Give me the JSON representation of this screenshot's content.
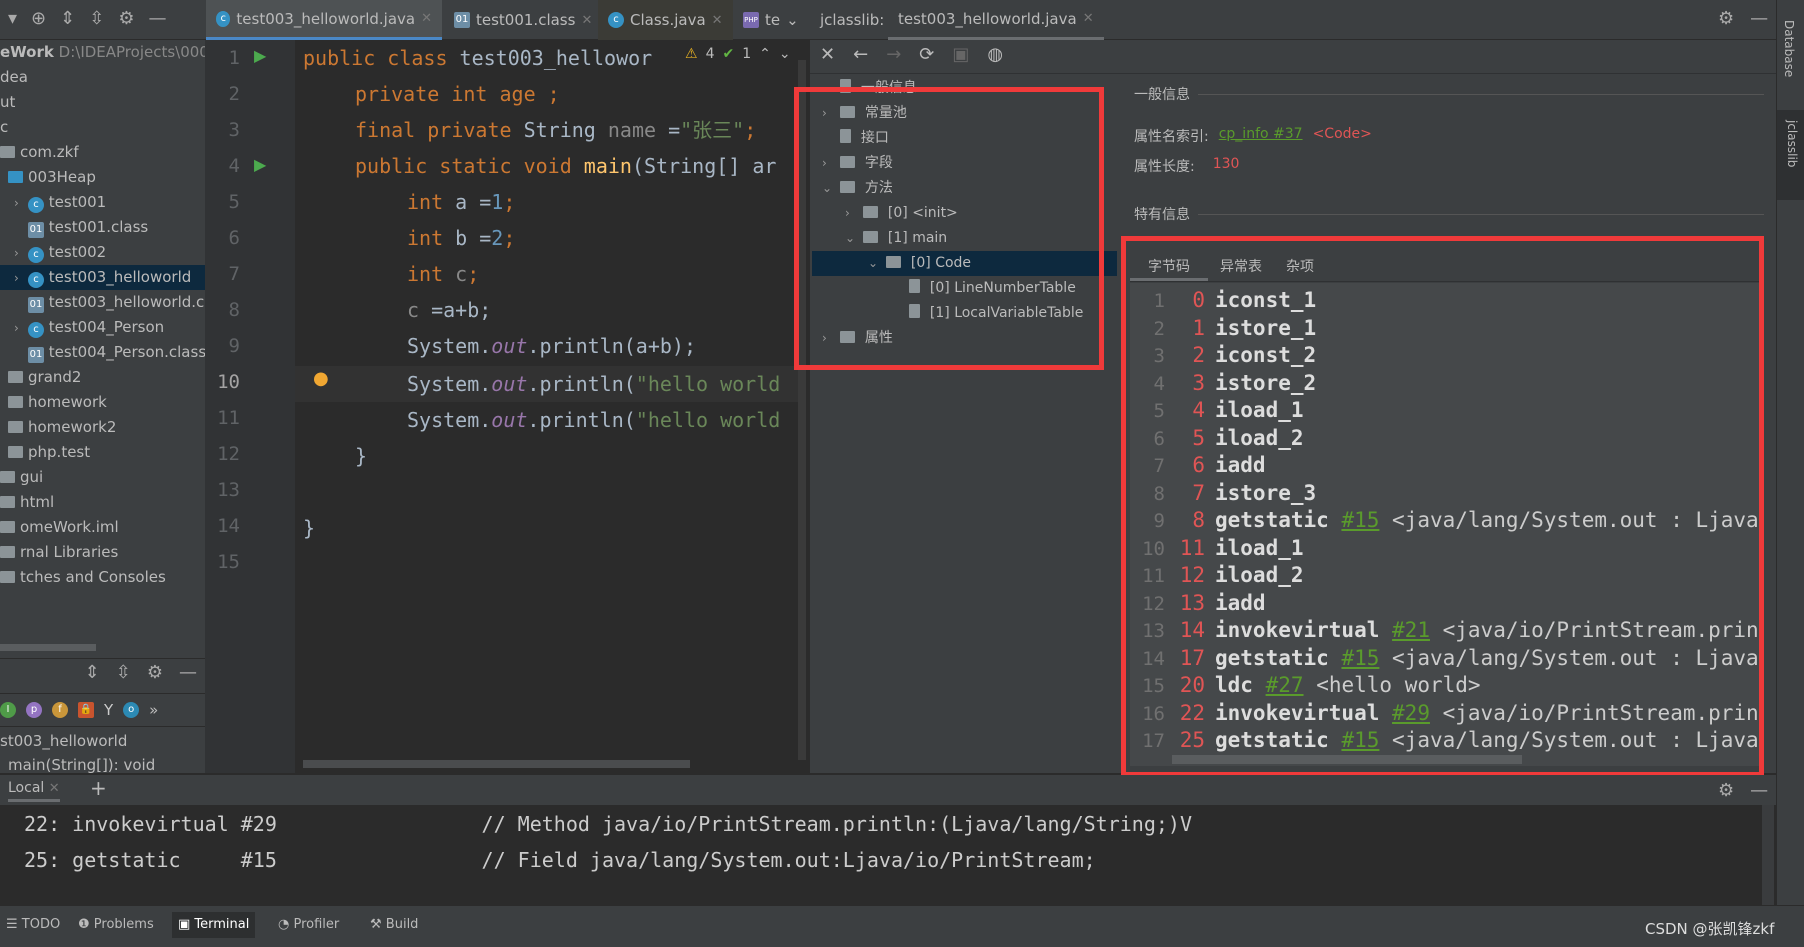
{
  "editor_tabs": [
    {
      "label": "test003_helloworld.java",
      "active": true
    },
    {
      "label": "test001.class"
    },
    {
      "label": "Class.java"
    },
    {
      "label": "te"
    }
  ],
  "project": {
    "root": "eWork",
    "root_path": "D:\\IDEAProjects\\000",
    "rows": [
      {
        "label": "dea",
        "indent": 0
      },
      {
        "label": "ut",
        "indent": 0
      },
      {
        "label": "c",
        "indent": 0
      },
      {
        "label": "com.zkf",
        "indent": 0
      },
      {
        "label": "003Heap",
        "indent": 1
      },
      {
        "label": "test001",
        "indent": 2,
        "arrow": true
      },
      {
        "label": "test001.class",
        "indent": 2
      },
      {
        "label": "test002",
        "indent": 2,
        "arrow": true
      },
      {
        "label": "test003_helloworld",
        "indent": 2,
        "arrow": true,
        "selected": true
      },
      {
        "label": "test003_helloworld.c",
        "indent": 2
      },
      {
        "label": "test004_Person",
        "indent": 2,
        "arrow": true
      },
      {
        "label": "test004_Person.class",
        "indent": 2
      },
      {
        "label": "grand2",
        "indent": 1
      },
      {
        "label": "homework",
        "indent": 1
      },
      {
        "label": "homework2",
        "indent": 1
      },
      {
        "label": "php.test",
        "indent": 1
      },
      {
        "label": "gui",
        "indent": 0
      },
      {
        "label": "html",
        "indent": 0
      },
      {
        "label": "omeWork.iml",
        "indent": 0
      },
      {
        "label": "rnal Libraries",
        "indent": 0
      },
      {
        "label": "tches and Consoles",
        "indent": 0
      }
    ]
  },
  "structure": {
    "class_name": "st003_helloworld",
    "method": "main(String[]): void"
  },
  "editor": {
    "inspections": {
      "warnings": "4",
      "ok": "1"
    },
    "lines": [
      "1",
      "2",
      "3",
      "4",
      "5",
      "6",
      "7",
      "8",
      "9",
      "10",
      "11",
      "12",
      "13",
      "14",
      "15"
    ],
    "code": {
      "l1a": "public class ",
      "l1b": "test003_hellowor",
      "l2a": "private int ",
      "l2b": "age ;",
      "l3a": "final private ",
      "l3b": "String ",
      "l3c": "name ",
      "l3d": "=",
      "l3e": "\"张三\"",
      "l3f": ";",
      "l4a": "public static void ",
      "l4b": "main",
      "l4c": "(String[] ar",
      "l5a": "int ",
      "l5b": "a =",
      "l5c": "1",
      "l5d": ";",
      "l6a": "int ",
      "l6b": "b =",
      "l6c": "2",
      "l6d": ";",
      "l7a": "int ",
      "l7b": "c",
      "l7c": ";",
      "l8a": "c ",
      "l8b": "=a+b;",
      "l9a": "System.",
      "l9b": "out",
      "l9c": ".println(a+b);",
      "l10a": "System.",
      "l10b": "out",
      "l10c": ".println(",
      "l10d": "\"hello world",
      "l11a": "System.",
      "l11b": "out",
      "l11c": ".println(",
      "l11d": "\"hello world",
      "l12": "}",
      "l14": "}"
    }
  },
  "jclasslib": {
    "title": "jclasslib:",
    "tab": "test003_helloworld.java",
    "tree": [
      {
        "label": "一般信息",
        "depth": 0
      },
      {
        "label": "常量池",
        "depth": 0,
        "arrow": "right"
      },
      {
        "label": "接口",
        "depth": 0
      },
      {
        "label": "字段",
        "depth": 0,
        "arrow": "right"
      },
      {
        "label": "方法",
        "depth": 0,
        "arrow": "down"
      },
      {
        "label": "[0] <init>",
        "depth": 1,
        "arrow": "right"
      },
      {
        "label": "[1] main",
        "depth": 1,
        "arrow": "down"
      },
      {
        "label": "[0] Code",
        "depth": 2,
        "arrow": "down",
        "selected": true
      },
      {
        "label": "[0] LineNumberTable",
        "depth": 3
      },
      {
        "label": "[1] LocalVariableTable",
        "depth": 3
      },
      {
        "label": "属性",
        "depth": 0,
        "arrow": "right"
      }
    ],
    "general": {
      "heading": "一般信息",
      "name_index_label": "属性名索引:",
      "name_index_link": "cp_info #37",
      "name_index_value": "<Code>",
      "length_label": "属性长度:",
      "length_value": "130"
    },
    "specific": {
      "heading": "特有信息",
      "tabs": [
        "字节码",
        "异常表",
        "杂项"
      ]
    },
    "bytecode": [
      {
        "n": "1",
        "o": "0",
        "op": "iconst_1"
      },
      {
        "n": "2",
        "o": "1",
        "op": "istore_1"
      },
      {
        "n": "3",
        "o": "2",
        "op": "iconst_2"
      },
      {
        "n": "4",
        "o": "3",
        "op": "istore_2"
      },
      {
        "n": "5",
        "o": "4",
        "op": "iload_1"
      },
      {
        "n": "6",
        "o": "5",
        "op": "iload_2"
      },
      {
        "n": "7",
        "o": "6",
        "op": "iadd"
      },
      {
        "n": "8",
        "o": "7",
        "op": "istore_3"
      },
      {
        "n": "9",
        "o": "8",
        "op": "getstatic",
        "ref": "#15",
        "cm": "<java/lang/System.out : Ljava"
      },
      {
        "n": "10",
        "o": "11",
        "op": "iload_1"
      },
      {
        "n": "11",
        "o": "12",
        "op": "iload_2"
      },
      {
        "n": "12",
        "o": "13",
        "op": "iadd"
      },
      {
        "n": "13",
        "o": "14",
        "op": "invokevirtual",
        "ref": "#21",
        "cm": "<java/io/PrintStream.prin"
      },
      {
        "n": "14",
        "o": "17",
        "op": "getstatic",
        "ref": "#15",
        "cm": "<java/lang/System.out : Ljava"
      },
      {
        "n": "15",
        "o": "20",
        "op": "ldc",
        "ref": "#27",
        "cm": "<hello world>"
      },
      {
        "n": "16",
        "o": "22",
        "op": "invokevirtual",
        "ref": "#29",
        "cm": "<java/io/PrintStream.prin"
      },
      {
        "n": "17",
        "o": "25",
        "op": "getstatic",
        "ref": "#15",
        "cm": "<java/lang/System.out : Ljava"
      }
    ]
  },
  "right_strip": {
    "database": "Database",
    "jclasslib": "jclasslib"
  },
  "terminal": {
    "tab": "Local",
    "lines": [
      "22: invokevirtual #29                 // Method java/io/PrintStream.println:(Ljava/lang/String;)V",
      "25: getstatic     #15                 // Field java/lang/System.out:Ljava/io/PrintStream;"
    ]
  },
  "bottom_tabs": [
    "TODO",
    "Problems",
    "Terminal",
    "Profiler",
    "Build"
  ],
  "watermark": "CSDN @张凯锋zkf",
  "colors": {
    "highlight_box": "#f03a3a",
    "accent": "#4a88c7",
    "selection": "#0d293e"
  }
}
